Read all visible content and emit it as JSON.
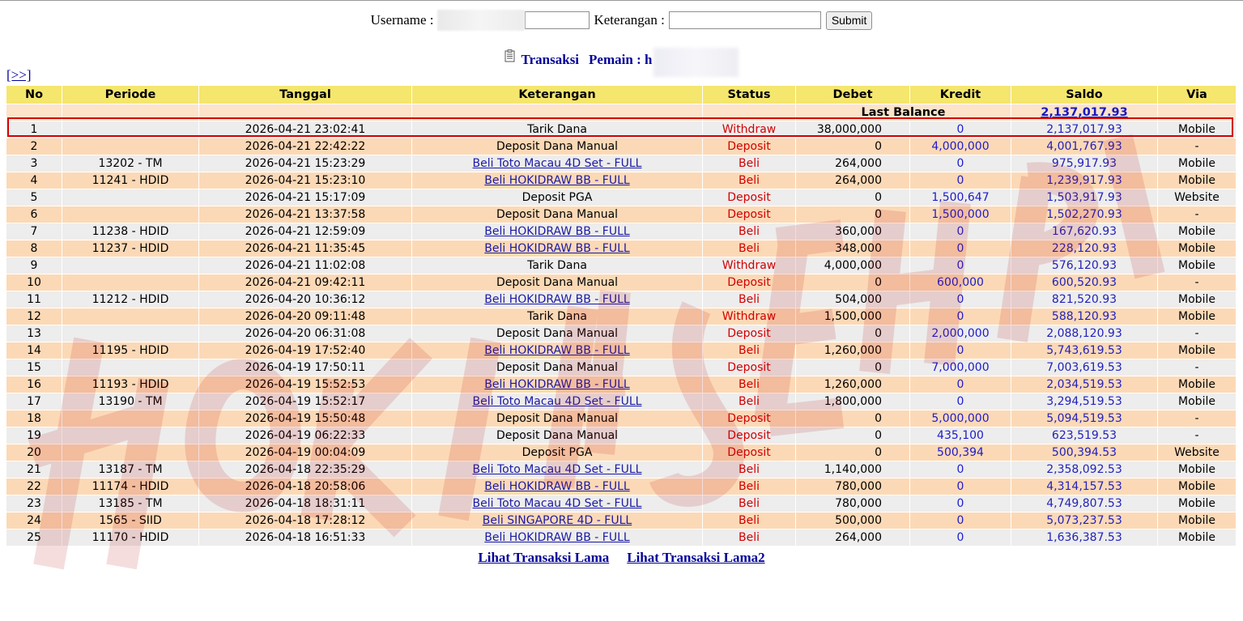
{
  "search": {
    "username_label": "Username :",
    "keterangan_label": "Keterangan :",
    "username_value": "",
    "keterangan_value": "",
    "submit_label": "Submit"
  },
  "heading": {
    "title": "Transaksi",
    "pemain_label": "Pemain : h"
  },
  "nav": {
    "next_label": "[>>]"
  },
  "table": {
    "headers": [
      "No",
      "Periode",
      "Tanggal",
      "Keterangan",
      "Status",
      "Debet",
      "Kredit",
      "Saldo",
      "Via"
    ],
    "last_balance_label": "Last Balance",
    "last_balance_value": "2,137,017.93",
    "rows": [
      {
        "no": "1",
        "periode": "",
        "tanggal": "2026-04-21 23:02:41",
        "keterangan": "Tarik Dana",
        "link": false,
        "status": "Withdraw",
        "debet": "38,000,000",
        "kredit": "0",
        "saldo": "2,137,017.93",
        "via": "Mobile"
      },
      {
        "no": "2",
        "periode": "",
        "tanggal": "2026-04-21 22:42:22",
        "keterangan": "Deposit Dana Manual",
        "link": false,
        "status": "Deposit",
        "debet": "0",
        "kredit": "4,000,000",
        "saldo": "4,001,767.93",
        "via": "-"
      },
      {
        "no": "3",
        "periode": "13202 - TM",
        "tanggal": "2026-04-21 15:23:29",
        "keterangan": "Beli Toto Macau 4D Set - FULL",
        "link": true,
        "status": "Beli",
        "debet": "264,000",
        "kredit": "0",
        "saldo": "975,917.93",
        "via": "Mobile"
      },
      {
        "no": "4",
        "periode": "11241 - HDID",
        "tanggal": "2026-04-21 15:23:10",
        "keterangan": "Beli HOKIDRAW BB - FULL",
        "link": true,
        "status": "Beli",
        "debet": "264,000",
        "kredit": "0",
        "saldo": "1,239,917.93",
        "via": "Mobile"
      },
      {
        "no": "5",
        "periode": "",
        "tanggal": "2026-04-21 15:17:09",
        "keterangan": "Deposit PGA",
        "link": false,
        "status": "Deposit",
        "debet": "0",
        "kredit": "1,500,647",
        "saldo": "1,503,917.93",
        "via": "Website"
      },
      {
        "no": "6",
        "periode": "",
        "tanggal": "2026-04-21 13:37:58",
        "keterangan": "Deposit Dana Manual",
        "link": false,
        "status": "Deposit",
        "debet": "0",
        "kredit": "1,500,000",
        "saldo": "1,502,270.93",
        "via": "-"
      },
      {
        "no": "7",
        "periode": "11238 - HDID",
        "tanggal": "2026-04-21 12:59:09",
        "keterangan": "Beli HOKIDRAW BB - FULL",
        "link": true,
        "status": "Beli",
        "debet": "360,000",
        "kredit": "0",
        "saldo": "167,620.93",
        "via": "Mobile"
      },
      {
        "no": "8",
        "periode": "11237 - HDID",
        "tanggal": "2026-04-21 11:35:45",
        "keterangan": "Beli HOKIDRAW BB - FULL",
        "link": true,
        "status": "Beli",
        "debet": "348,000",
        "kredit": "0",
        "saldo": "228,120.93",
        "via": "Mobile"
      },
      {
        "no": "9",
        "periode": "",
        "tanggal": "2026-04-21 11:02:08",
        "keterangan": "Tarik Dana",
        "link": false,
        "status": "Withdraw",
        "debet": "4,000,000",
        "kredit": "0",
        "saldo": "576,120.93",
        "via": "Mobile"
      },
      {
        "no": "10",
        "periode": "",
        "tanggal": "2026-04-21 09:42:11",
        "keterangan": "Deposit Dana Manual",
        "link": false,
        "status": "Deposit",
        "debet": "0",
        "kredit": "600,000",
        "saldo": "600,520.93",
        "via": "-"
      },
      {
        "no": "11",
        "periode": "11212 - HDID",
        "tanggal": "2026-04-20 10:36:12",
        "keterangan": "Beli HOKIDRAW BB - FULL",
        "link": true,
        "status": "Beli",
        "debet": "504,000",
        "kredit": "0",
        "saldo": "821,520.93",
        "via": "Mobile"
      },
      {
        "no": "12",
        "periode": "",
        "tanggal": "2026-04-20 09:11:48",
        "keterangan": "Tarik Dana",
        "link": false,
        "status": "Withdraw",
        "debet": "1,500,000",
        "kredit": "0",
        "saldo": "588,120.93",
        "via": "Mobile"
      },
      {
        "no": "13",
        "periode": "",
        "tanggal": "2026-04-20 06:31:08",
        "keterangan": "Deposit Dana Manual",
        "link": false,
        "status": "Deposit",
        "debet": "0",
        "kredit": "2,000,000",
        "saldo": "2,088,120.93",
        "via": "-"
      },
      {
        "no": "14",
        "periode": "11195 - HDID",
        "tanggal": "2026-04-19 17:52:40",
        "keterangan": "Beli HOKIDRAW BB - FULL",
        "link": true,
        "status": "Beli",
        "debet": "1,260,000",
        "kredit": "0",
        "saldo": "5,743,619.53",
        "via": "Mobile"
      },
      {
        "no": "15",
        "periode": "",
        "tanggal": "2026-04-19 17:50:11",
        "keterangan": "Deposit Dana Manual",
        "link": false,
        "status": "Deposit",
        "debet": "0",
        "kredit": "7,000,000",
        "saldo": "7,003,619.53",
        "via": "-"
      },
      {
        "no": "16",
        "periode": "11193 - HDID",
        "tanggal": "2026-04-19 15:52:53",
        "keterangan": "Beli HOKIDRAW BB - FULL",
        "link": true,
        "status": "Beli",
        "debet": "1,260,000",
        "kredit": "0",
        "saldo": "2,034,519.53",
        "via": "Mobile"
      },
      {
        "no": "17",
        "periode": "13190 - TM",
        "tanggal": "2026-04-19 15:52:17",
        "keterangan": "Beli Toto Macau 4D Set - FULL",
        "link": true,
        "status": "Beli",
        "debet": "1,800,000",
        "kredit": "0",
        "saldo": "3,294,519.53",
        "via": "Mobile"
      },
      {
        "no": "18",
        "periode": "",
        "tanggal": "2026-04-19 15:50:48",
        "keterangan": "Deposit Dana Manual",
        "link": false,
        "status": "Deposit",
        "debet": "0",
        "kredit": "5,000,000",
        "saldo": "5,094,519.53",
        "via": "-"
      },
      {
        "no": "19",
        "periode": "",
        "tanggal": "2026-04-19 06:22:33",
        "keterangan": "Deposit Dana Manual",
        "link": false,
        "status": "Deposit",
        "debet": "0",
        "kredit": "435,100",
        "saldo": "623,519.53",
        "via": "-"
      },
      {
        "no": "20",
        "periode": "",
        "tanggal": "2026-04-19 00:04:09",
        "keterangan": "Deposit PGA",
        "link": false,
        "status": "Deposit",
        "debet": "0",
        "kredit": "500,394",
        "saldo": "500,394.53",
        "via": "Website"
      },
      {
        "no": "21",
        "periode": "13187 - TM",
        "tanggal": "2026-04-18 22:35:29",
        "keterangan": "Beli Toto Macau 4D Set - FULL",
        "link": true,
        "status": "Beli",
        "debet": "1,140,000",
        "kredit": "0",
        "saldo": "2,358,092.53",
        "via": "Mobile"
      },
      {
        "no": "22",
        "periode": "11174 - HDID",
        "tanggal": "2026-04-18 20:58:06",
        "keterangan": "Beli HOKIDRAW BB - FULL",
        "link": true,
        "status": "Beli",
        "debet": "780,000",
        "kredit": "0",
        "saldo": "4,314,157.53",
        "via": "Mobile"
      },
      {
        "no": "23",
        "periode": "13185 - TM",
        "tanggal": "2026-04-18 18:31:11",
        "keterangan": "Beli Toto Macau 4D Set - FULL",
        "link": true,
        "status": "Beli",
        "debet": "780,000",
        "kredit": "0",
        "saldo": "4,749,807.53",
        "via": "Mobile"
      },
      {
        "no": "24",
        "periode": "1565 - SIID",
        "tanggal": "2026-04-18 17:28:12",
        "keterangan": "Beli SINGAPORE 4D - FULL",
        "link": true,
        "status": "Beli",
        "debet": "500,000",
        "kredit": "0",
        "saldo": "5,073,237.53",
        "via": "Mobile"
      },
      {
        "no": "25",
        "periode": "11170 - HDID",
        "tanggal": "2026-04-18 16:51:33",
        "keterangan": "Beli HOKIDRAW BB - FULL",
        "link": true,
        "status": "Beli",
        "debet": "264,000",
        "kredit": "0",
        "saldo": "1,636,387.53",
        "via": "Mobile"
      }
    ]
  },
  "footer": {
    "link1": "Lihat Transaksi Lama",
    "link2": "Lihat Transaksi Lama2"
  },
  "colors": {
    "header_bg": "#f5e66e",
    "row_odd": "#ededed",
    "row_even": "#fcd9b6",
    "status_red": "#d10000",
    "link_blue": "#000099",
    "highlight_border": "#d70000"
  },
  "icons": {
    "heading_icon": "document-icon"
  }
}
